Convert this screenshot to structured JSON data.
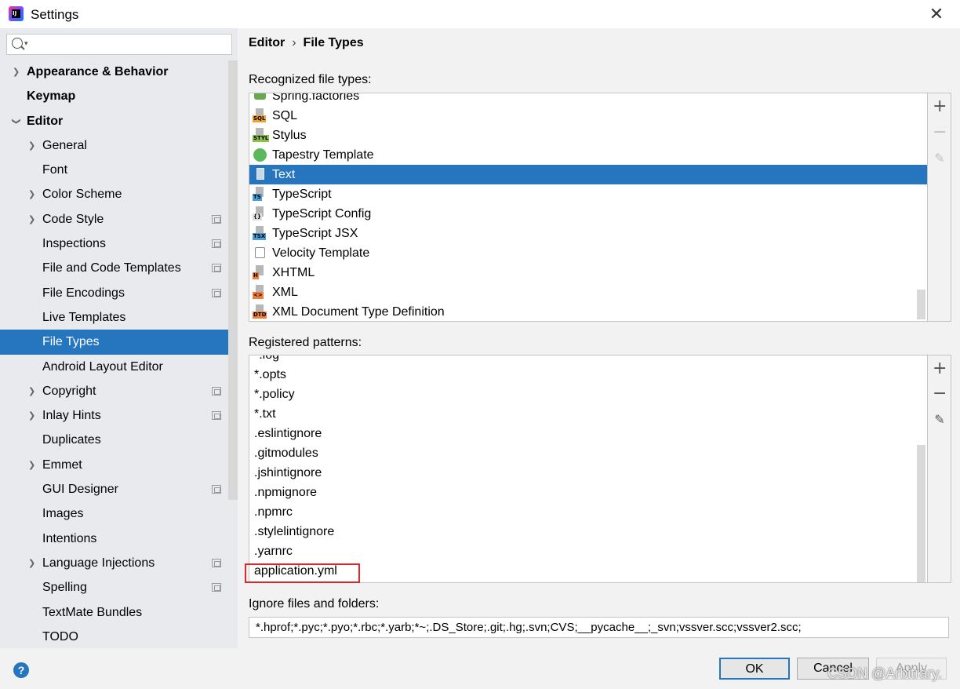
{
  "window": {
    "title": "Settings",
    "close_glyph": "✕",
    "app_icon_text": "IJ"
  },
  "search": {
    "placeholder": "",
    "caret": "▾"
  },
  "sidebar": {
    "items": [
      {
        "label": "Appearance & Behavior",
        "level": 0,
        "chevron": "right",
        "bold": true,
        "proj": false
      },
      {
        "label": "Keymap",
        "level": 0,
        "chevron": "none",
        "bold": true,
        "proj": false
      },
      {
        "label": "Editor",
        "level": 0,
        "chevron": "down",
        "bold": true,
        "proj": false
      },
      {
        "label": "General",
        "level": 1,
        "chevron": "right",
        "bold": false,
        "proj": false
      },
      {
        "label": "Font",
        "level": 1,
        "chevron": "none",
        "bold": false,
        "proj": false
      },
      {
        "label": "Color Scheme",
        "level": 1,
        "chevron": "right",
        "bold": false,
        "proj": false
      },
      {
        "label": "Code Style",
        "level": 1,
        "chevron": "right",
        "bold": false,
        "proj": true
      },
      {
        "label": "Inspections",
        "level": 1,
        "chevron": "none",
        "bold": false,
        "proj": true
      },
      {
        "label": "File and Code Templates",
        "level": 1,
        "chevron": "none",
        "bold": false,
        "proj": true
      },
      {
        "label": "File Encodings",
        "level": 1,
        "chevron": "none",
        "bold": false,
        "proj": true
      },
      {
        "label": "Live Templates",
        "level": 1,
        "chevron": "none",
        "bold": false,
        "proj": false
      },
      {
        "label": "File Types",
        "level": 1,
        "chevron": "none",
        "bold": false,
        "proj": false,
        "selected": true
      },
      {
        "label": "Android Layout Editor",
        "level": 1,
        "chevron": "none",
        "bold": false,
        "proj": false
      },
      {
        "label": "Copyright",
        "level": 1,
        "chevron": "right",
        "bold": false,
        "proj": true
      },
      {
        "label": "Inlay Hints",
        "level": 1,
        "chevron": "right",
        "bold": false,
        "proj": true
      },
      {
        "label": "Duplicates",
        "level": 1,
        "chevron": "none",
        "bold": false,
        "proj": false
      },
      {
        "label": "Emmet",
        "level": 1,
        "chevron": "right",
        "bold": false,
        "proj": false
      },
      {
        "label": "GUI Designer",
        "level": 1,
        "chevron": "none",
        "bold": false,
        "proj": true
      },
      {
        "label": "Images",
        "level": 1,
        "chevron": "none",
        "bold": false,
        "proj": false
      },
      {
        "label": "Intentions",
        "level": 1,
        "chevron": "none",
        "bold": false,
        "proj": false
      },
      {
        "label": "Language Injections",
        "level": 1,
        "chevron": "right",
        "bold": false,
        "proj": true
      },
      {
        "label": "Spelling",
        "level": 1,
        "chevron": "none",
        "bold": false,
        "proj": true
      },
      {
        "label": "TextMate Bundles",
        "level": 1,
        "chevron": "none",
        "bold": false,
        "proj": false
      },
      {
        "label": "TODO",
        "level": 1,
        "chevron": "none",
        "bold": false,
        "proj": false
      }
    ]
  },
  "breadcrumb": {
    "parent": "Editor",
    "separator": "›",
    "current": "File Types"
  },
  "recognized": {
    "label": "Recognized file types:",
    "items": [
      {
        "name": "Spring.factories",
        "icon": "spring-factories-icon",
        "badge": "",
        "badge_color": "#6aa84f"
      },
      {
        "name": "SQL",
        "icon": "sql-icon",
        "badge": "SQL",
        "badge_color": "#f0a030"
      },
      {
        "name": "Stylus",
        "icon": "stylus-icon",
        "badge": "STYL",
        "badge_color": "#8bc34a"
      },
      {
        "name": "Tapestry Template",
        "icon": "tapestry-icon",
        "badge": "",
        "badge_color": "#5bb85b"
      },
      {
        "name": "Text",
        "icon": "text-file-icon",
        "badge": "",
        "badge_color": "#9e9e9e",
        "selected": true
      },
      {
        "name": "TypeScript",
        "icon": "typescript-icon",
        "badge": "TS",
        "badge_color": "#4a9fd6"
      },
      {
        "name": "TypeScript Config",
        "icon": "typescript-config-icon",
        "badge": "{}",
        "badge_color": "#dddddd"
      },
      {
        "name": "TypeScript JSX",
        "icon": "typescript-jsx-icon",
        "badge": "TSX",
        "badge_color": "#4a9fd6"
      },
      {
        "name": "Velocity Template",
        "icon": "velocity-icon",
        "badge": "",
        "badge_color": "#888888"
      },
      {
        "name": "XHTML",
        "icon": "xhtml-icon",
        "badge": "H",
        "badge_color": "#ef7d3c"
      },
      {
        "name": "XML",
        "icon": "xml-icon",
        "badge": "<>",
        "badge_color": "#ef7d3c"
      },
      {
        "name": "XML Document Type Definition",
        "icon": "dtd-icon",
        "badge": "DTD",
        "badge_color": "#ef7d3c"
      }
    ]
  },
  "patterns": {
    "label": "Registered patterns:",
    "items": [
      "*.log",
      "*.opts",
      "*.policy",
      "*.txt",
      ".eslintignore",
      ".gitmodules",
      ".jshintignore",
      ".npmignore",
      ".npmrc",
      ".stylelintignore",
      ".yarnrc",
      "application.yml"
    ]
  },
  "tools": {
    "add": "+",
    "remove": "−",
    "edit": "✎"
  },
  "ignore": {
    "label": "Ignore files and folders:",
    "value": "*.hprof;*.pyc;*.pyo;*.rbc;*.yarb;*~;.DS_Store;.git;.hg;.svn;CVS;__pycache__;_svn;vssver.scc;vssver2.scc;"
  },
  "footer": {
    "help": "?",
    "ok": "OK",
    "cancel": "Cancel",
    "apply": "Apply",
    "watermark": "CSDN @Arbitrary."
  },
  "colors": {
    "selection": "#2675bf",
    "highlight": "#e0262b",
    "sidebar_bg": "#e8eaee"
  }
}
